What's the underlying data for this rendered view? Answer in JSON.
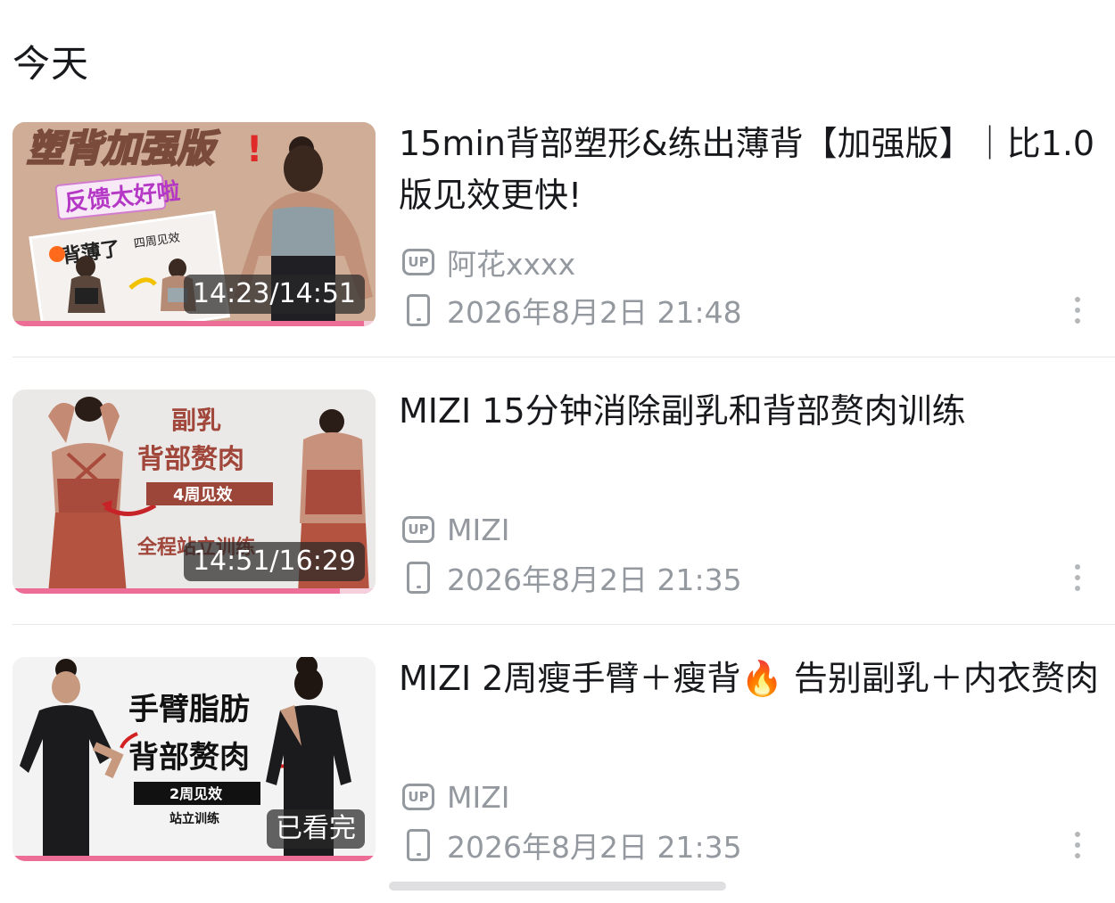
{
  "section": {
    "title": "今天"
  },
  "videos": [
    {
      "title": "15min背部塑形&练出薄背【加强版】｜比1.0版见效更快!",
      "uploader": "阿花xxxx",
      "watched_at": "2026年8月2日 21:48",
      "duration_label": "14:23/14:51",
      "progress": 0.969,
      "thumbnail_text": {
        "headline": "塑背加强版",
        "tag": "反馈太好啦",
        "sub": "背薄了",
        "note": "四周见效"
      }
    },
    {
      "title": "MIZI 15分钟消除副乳和背部赘肉训练",
      "uploader": "MIZI",
      "watched_at": "2026年8月2日 21:35",
      "duration_label": "14:51/16:29",
      "progress": 0.901,
      "thumbnail_text": {
        "line1": "副乳",
        "line2": "背部赘肉",
        "badge": "4周见效",
        "line3": "全程站立训练"
      }
    },
    {
      "title": "MIZI 2周瘦手臂＋瘦背🔥 告别副乳＋内衣赘肉",
      "uploader": "MIZI",
      "watched_at": "2026年8月2日 21:35",
      "duration_label": "已看完",
      "progress": 1.0,
      "thumbnail_text": {
        "line1": "手臂脂肪",
        "line2": "背部赘肉",
        "badge": "2周见效",
        "line3": "站立训练"
      }
    }
  ],
  "icons": {
    "up_badge": "UP",
    "uploader_icon": "up-badge-icon",
    "device_icon": "phone-icon",
    "more_icon": "more-vertical-icon"
  },
  "colors": {
    "progress": "#ec6d95",
    "meta_text": "#9499a0",
    "title_text": "#18191c"
  }
}
